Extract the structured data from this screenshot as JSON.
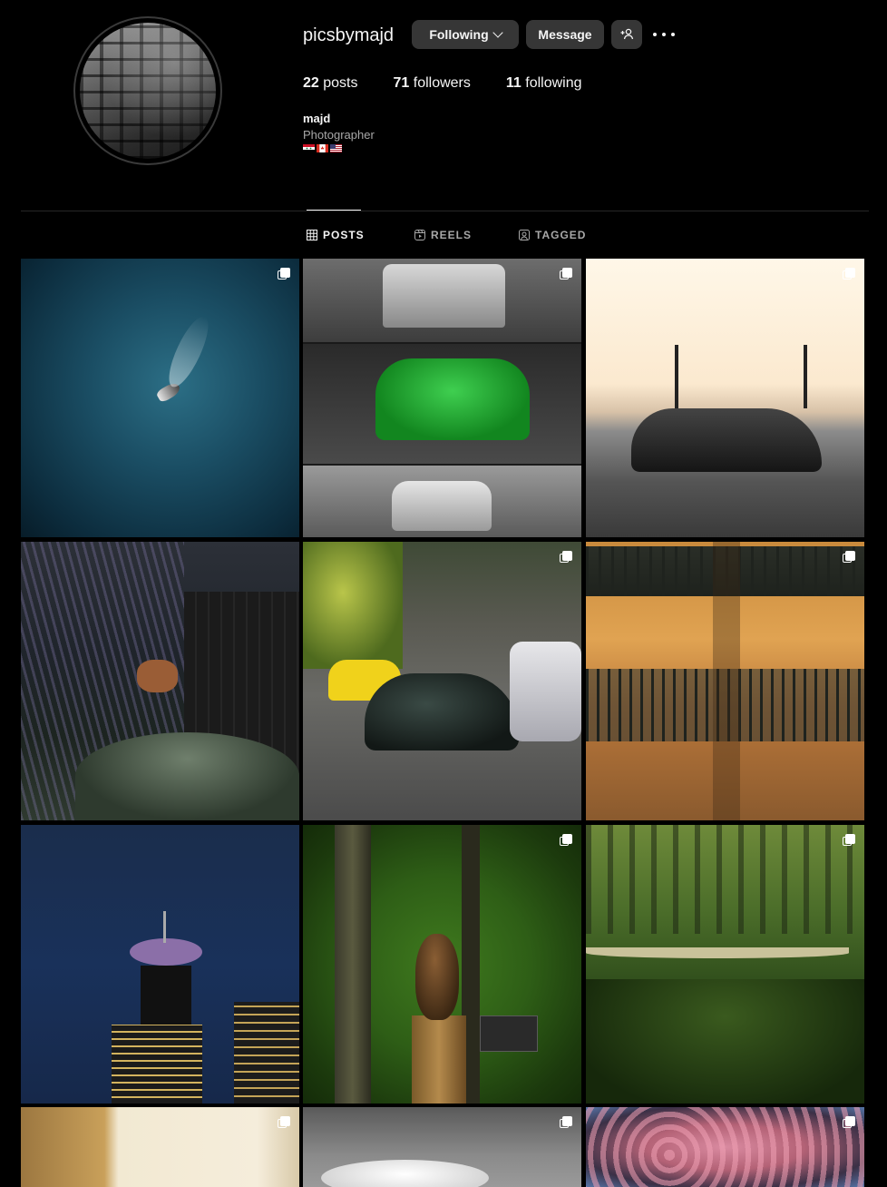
{
  "profile": {
    "username": "picsbymajd",
    "name": "majd",
    "bio": "Photographer",
    "flags": [
      "flag-syria-icon",
      "flag-canada-icon",
      "flag-usa-icon"
    ]
  },
  "actions": {
    "following_label": "Following",
    "message_label": "Message",
    "add_user_icon": "add-user-icon",
    "more_icon": "more-options-icon"
  },
  "stats": {
    "posts_count": "22",
    "posts_label": "posts",
    "followers_count": "71",
    "followers_label": "followers",
    "following_count": "11",
    "following_label": "following"
  },
  "tabs": [
    {
      "label": "POSTS",
      "icon": "grid-icon",
      "active": true
    },
    {
      "label": "REELS",
      "icon": "reels-icon",
      "active": false
    },
    {
      "label": "TAGGED",
      "icon": "tagged-icon",
      "active": false
    }
  ],
  "grid": [
    {
      "subject": "boat on water",
      "multi": true
    },
    {
      "subject": "cars collage",
      "multi": true
    },
    {
      "subject": "sports car at sunset",
      "multi": true
    },
    {
      "subject": "deer among lupines",
      "multi": false
    },
    {
      "subject": "classic car on street",
      "multi": true
    },
    {
      "subject": "apartment balconies",
      "multi": true
    },
    {
      "subject": "lookout tower at night",
      "multi": false
    },
    {
      "subject": "hawk on post",
      "multi": true
    },
    {
      "subject": "suspension bridge in forest",
      "multi": true
    },
    {
      "subject": "building wall",
      "multi": true
    },
    {
      "subject": "clouds",
      "multi": true
    },
    {
      "subject": "cherry blossoms",
      "multi": true
    }
  ]
}
